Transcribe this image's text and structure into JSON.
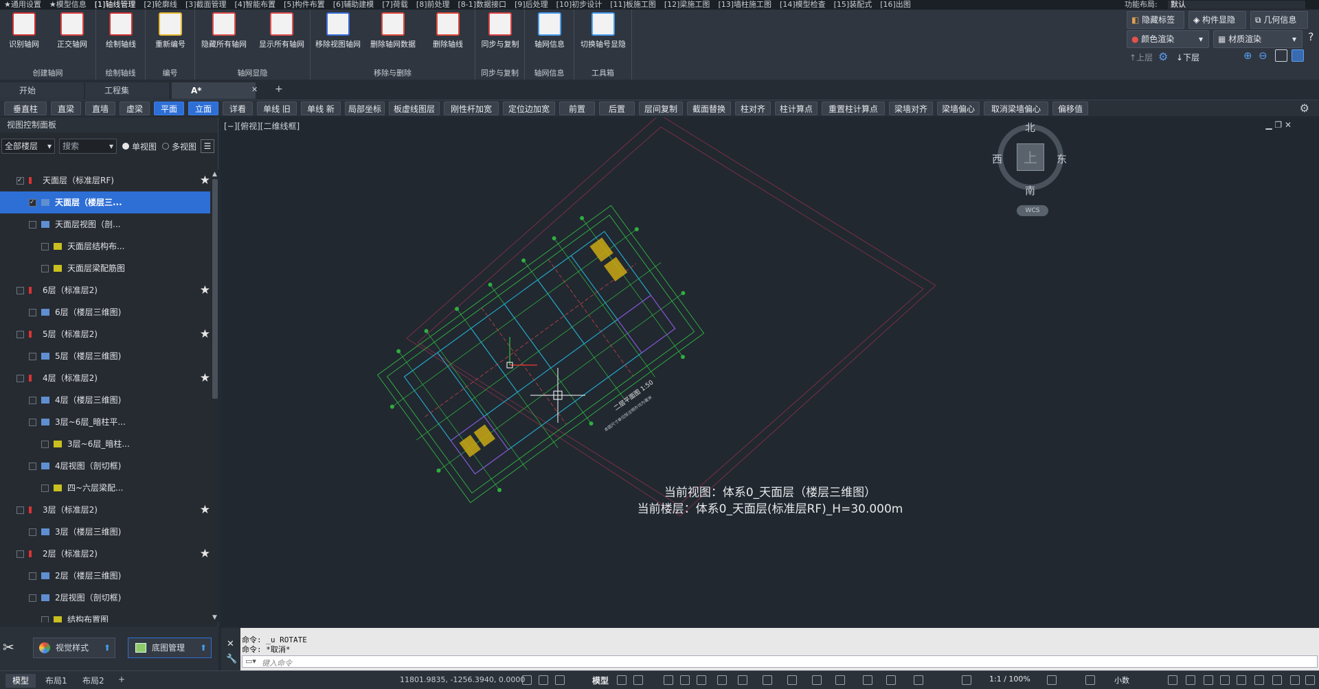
{
  "menubar": {
    "items": [
      "★通用设置",
      "★模型信息",
      "[1]轴线管理",
      "[2]轮廓线",
      "[3]截面管理",
      "[4]智能布置",
      "[5]构件布置",
      "[6]辅助建模",
      "[7]荷载",
      "[8]前处理",
      "[8-1]数据接口",
      "[9]后处理",
      "[10]初步设计",
      "[11]板施工图",
      "[12]梁施工图",
      "[13]墙柱施工图",
      "[14]模型检查",
      "[15]装配式",
      "[16]出图"
    ],
    "active_index": 2,
    "layout_label": "功能布局:",
    "layout_value": "默认"
  },
  "ribbon": {
    "groups": [
      {
        "name": "创建轴网",
        "buttons": [
          "识别轴网",
          "正交轴网"
        ]
      },
      {
        "name": "绘制轴线",
        "buttons": [
          "绘制轴线"
        ]
      },
      {
        "name": "编号",
        "buttons": [
          "重新编号"
        ]
      },
      {
        "name": "轴网显隐",
        "buttons": [
          "隐藏所有轴网",
          "显示所有轴网"
        ]
      },
      {
        "name": "移除与删除",
        "buttons": [
          "移除视图轴网",
          "删除轴网数据",
          "删除轴线"
        ]
      },
      {
        "name": "同步与复制",
        "buttons": [
          "同步与复制"
        ]
      },
      {
        "name": "轴网信息",
        "buttons": [
          "轴网信息"
        ]
      },
      {
        "name": "工具箱",
        "buttons": [
          "切换轴号显隐"
        ]
      }
    ]
  },
  "right_panel": {
    "hide_label": "隐藏标签",
    "component_visibility": "构件显隐",
    "geometry_info": "几何信息",
    "color_render": "颜色渲染",
    "material_render": "材质渲染",
    "upper_floor": "上层",
    "lower_floor": "下层"
  },
  "tabs": [
    {
      "label": "开始",
      "active": false
    },
    {
      "label": "工程集",
      "active": false
    },
    {
      "label": "A*",
      "active": true
    }
  ],
  "toolbar2": {
    "buttons": [
      "垂直柱",
      "直梁",
      "直墙",
      "虚梁",
      "平面",
      "立面",
      "详看",
      "单线 旧",
      "单线 新",
      "局部坐标",
      "板虚线图层",
      "刚性杆加宽",
      "定位边加宽",
      "前置",
      "后置",
      "层间复制",
      "截面替换",
      "柱对齐",
      "柱计算点",
      "重置柱计算点",
      "梁墙对齐",
      "梁墙偏心",
      "取消梁墙偏心",
      "偏移值"
    ],
    "selected": [
      "平面",
      "立面"
    ]
  },
  "left_panel": {
    "title": "视图控制面板",
    "floor_filter": "全部楼层",
    "search_placeholder": "搜索",
    "single_view": "单视图",
    "multi_view": "多视图",
    "tree": [
      {
        "label": "天面层（标准层RF)",
        "level": 0,
        "star": true,
        "checked": true
      },
      {
        "label": "天面层（楼层三...",
        "level": 1,
        "selected": true,
        "checked": true
      },
      {
        "label": "天面层视图（剖...",
        "level": 1
      },
      {
        "label": "天面层结构布...",
        "level": 2
      },
      {
        "label": "天面层梁配筋图",
        "level": 2
      },
      {
        "label": "6层（标准层2)",
        "level": 0,
        "star": true
      },
      {
        "label": "6层（楼层三维图)",
        "level": 1
      },
      {
        "label": "5层（标准层2)",
        "level": 0,
        "star": true
      },
      {
        "label": "5层（楼层三维图)",
        "level": 1
      },
      {
        "label": "4层（标准层2)",
        "level": 0,
        "star": true
      },
      {
        "label": "4层（楼层三维图)",
        "level": 1
      },
      {
        "label": "3层~6层_暗柱平...",
        "level": 1
      },
      {
        "label": "3层~6层_暗柱...",
        "level": 2
      },
      {
        "label": "4层视图（剖切框)",
        "level": 1
      },
      {
        "label": "四~六层梁配...",
        "level": 2
      },
      {
        "label": "3层（标准层2)",
        "level": 0,
        "star": true
      },
      {
        "label": "3层（楼层三维图)",
        "level": 1
      },
      {
        "label": "2层（标准层2)",
        "level": 0,
        "star": true
      },
      {
        "label": "2层（楼层三维图)",
        "level": 1
      },
      {
        "label": "2层视图（剖切框)",
        "level": 1
      },
      {
        "label": "结构布置图",
        "level": 2
      }
    ],
    "bottom_buttons": [
      "视觉样式",
      "底图管理"
    ]
  },
  "viewport": {
    "label": "[−][俯视][二维线框]",
    "compass": {
      "north": "北",
      "south": "南",
      "east": "东",
      "west": "西",
      "top": "上",
      "wcs": "WCS"
    },
    "current_view": "当前视图：体系0_天面层（楼层三维图）",
    "current_floor": "当前楼层：体系0_天面层(标准层RF)_H=30.000m",
    "plan_title": "二层平面图 1:50",
    "plan_subtitle": "本图尺寸单位除注明外均为毫米"
  },
  "command": {
    "line1": "命令: _u ROTATE",
    "line2": "命令: *取消*",
    "placeholder": "键入命令"
  },
  "statusbar": {
    "tabs": [
      "模型",
      "布局1",
      "布局2"
    ],
    "coords": "11801.9835, -1256.3940, 0.0000",
    "model": "模型",
    "scale": "1:1 / 100%",
    "decimal": "小数"
  }
}
